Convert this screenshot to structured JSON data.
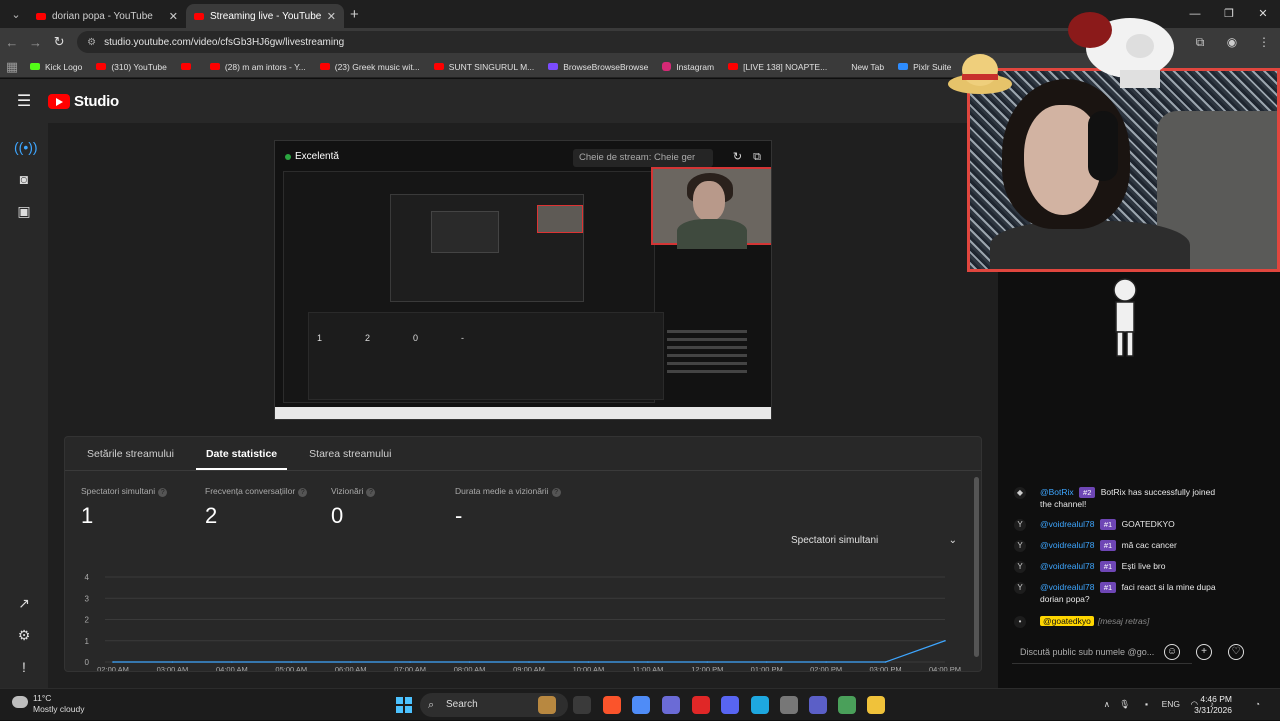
{
  "browser": {
    "tabs": [
      {
        "title": "dorian popa - YouTube",
        "active": false
      },
      {
        "title": "Streaming live - YouTube Studi",
        "active": true
      }
    ],
    "new_tab_symbol": "+",
    "url": "studio.youtube.com/video/cfsGb3HJ6gw/livestreaming",
    "bookmarks": [
      {
        "label": "Kick Logo",
        "icon": "kick-icon"
      },
      {
        "label": "(310) YouTube",
        "icon": "youtube-icon"
      },
      {
        "label": "",
        "icon": "youtube-icon"
      },
      {
        "label": "(28) m am intors - Y...",
        "icon": "youtube-icon"
      },
      {
        "label": "(23) Greek music wit...",
        "icon": "youtube-icon"
      },
      {
        "label": "SUNT SINGURUL M...",
        "icon": "youtube-icon"
      },
      {
        "label": "BrowseBrowseBrowse",
        "icon": "browse-icon"
      },
      {
        "label": "Instagram",
        "icon": "instagram-icon"
      },
      {
        "label": "[LIVE 138] NOAPTE...",
        "icon": "youtube-icon"
      },
      {
        "label": "New Tab",
        "icon": ""
      },
      {
        "label": "Pixlr Suite",
        "icon": "pixlr-icon"
      }
    ]
  },
  "studio": {
    "logo_text": "Studio",
    "preview": {
      "quality": "Excelentă",
      "stream_key_placeholder": "Cheie de stream: Cheie ger"
    },
    "stat_tabs": [
      {
        "label": "Setările streamului",
        "active": false
      },
      {
        "label": "Date statistice",
        "active": true
      },
      {
        "label": "Starea streamului",
        "active": false
      }
    ],
    "metrics": [
      {
        "label": "Spectatori simultani",
        "value": "1"
      },
      {
        "label": "Frecvența conversațiilor",
        "value": "2"
      },
      {
        "label": "Vizionări",
        "value": "0"
      },
      {
        "label": "Durata medie a vizionării",
        "value": "-"
      }
    ],
    "metric_select": "Spectatori simultani",
    "mini_metric_values": [
      "1",
      "2",
      "0",
      "-"
    ]
  },
  "chart_data": {
    "type": "line",
    "y_ticks": [
      "4",
      "3",
      "2",
      "1",
      "0"
    ],
    "ylim": [
      0,
      4
    ],
    "x_tick_labels": [
      "02:00 AM",
      "03:00 AM",
      "04:00 AM",
      "05:00 AM",
      "06:00 AM",
      "07:00 AM",
      "08:00 AM",
      "09:00 AM",
      "10:00 AM",
      "11:00 AM",
      "12:00 PM",
      "01:00 PM",
      "02:00 PM",
      "03:00 PM",
      "04:00 PM"
    ],
    "series": [
      {
        "values": [
          0,
          0,
          0,
          0,
          0,
          0,
          0,
          0,
          0,
          0,
          0,
          0,
          0,
          0,
          1
        ]
      }
    ],
    "grid": true,
    "accent_color": "#3ea6ff"
  },
  "chat": {
    "messages": [
      {
        "author": "@BotRix",
        "badge": "#2",
        "text": "BotRix has successfully joined the channel!",
        "verified": true
      },
      {
        "author": "@voidrealul78",
        "badge": "#1",
        "text": "GOATEDKYO",
        "verified": true
      },
      {
        "author": "@voidrealul78",
        "badge": "#1",
        "text": "mă cac cancer",
        "verified": true
      },
      {
        "author": "@voidrealul78",
        "badge": "#1",
        "text": "Ești live bro",
        "verified": true
      },
      {
        "author": "@voidrealul78",
        "badge": "#1",
        "text": "faci react si la mine dupa dorian popa?",
        "verified": true
      }
    ],
    "retracted": {
      "author": "@goatedkyo",
      "text": "[mesaj retras]"
    },
    "input_placeholder": "Discută public sub numele @go..."
  },
  "taskbar": {
    "weather_temp": "11°C",
    "weather_desc": "Mostly cloudy",
    "search_label": "Search",
    "language": "ENG",
    "time": "4:46 PM",
    "date": "3/31/2026"
  }
}
